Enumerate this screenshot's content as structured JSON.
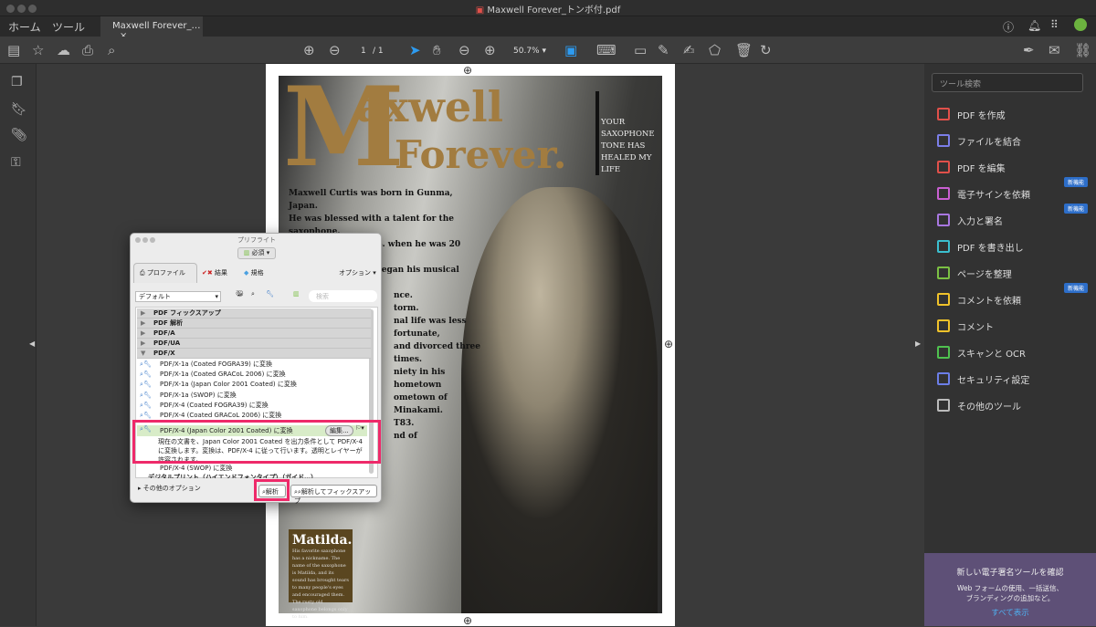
{
  "window": {
    "title": "Maxwell Forever_トンボ付.pdf"
  },
  "tabs": {
    "home": "ホーム",
    "tools": "ツール",
    "document": "Maxwell Forever_…",
    "close": "×"
  },
  "toolbar": {
    "page_current": "1",
    "page_total": "/ 1",
    "zoom": "50.7%",
    "icons": [
      "save-icon",
      "star-icon",
      "cloud-upload-icon",
      "print-icon",
      "search-zoom-icon",
      "page-up-icon",
      "page-down-icon",
      "select-arrow-icon",
      "hand-icon",
      "zoom-out-icon",
      "zoom-in-icon",
      "fit-page-icon",
      "scroll-mode-icon",
      "comment-icon",
      "highlight-icon",
      "sign-icon",
      "stamp-icon",
      "delete-icon",
      "rotate-icon",
      "share-sign-icon",
      "mail-icon"
    ]
  },
  "document": {
    "title_m": "M",
    "title_1": "axwell",
    "title_2": "Forever.",
    "tagline": "YOUR SAXOPHONE TONE HAS HEALED MY LIFE",
    "bio": [
      "Maxwell Curtis was born in Gunma, Japan.",
      "He was blessed with a talent for the saxophone.",
      "He moved to the U.S. when he was 20 years old",
      "New York City and began his musical career.",
      "nce.",
      "torm.",
      "nal life was less fortunate,",
      "and divorced three times.",
      "niety in his hometown",
      "ometown of Minakami.",
      "T83.",
      "nd of"
    ],
    "matilda_title": "Matilda.",
    "matilda_text": "His favorite saxophone has a nickname. The name of the saxophone is Matilda, and its sound has brought tears to many people's eyes and encouraged them. The rusty old saxophone belongs only to him."
  },
  "right_panel": {
    "search_placeholder": "ツール検索",
    "items": [
      {
        "label": "PDF を作成",
        "color": "#e0504a"
      },
      {
        "label": "ファイルを結合",
        "color": "#7b7ee8"
      },
      {
        "label": "PDF を編集",
        "color": "#e0504a"
      },
      {
        "label": "電子サインを依頼",
        "color": "#c95fd1",
        "badge": "新機能"
      },
      {
        "label": "入力と署名",
        "color": "#a877e0",
        "badge": "新機能"
      },
      {
        "label": "PDF を書き出し",
        "color": "#3bbfcf"
      },
      {
        "label": "ページを整理",
        "color": "#7bc043"
      },
      {
        "label": "コメントを依頼",
        "color": "#f0c22a",
        "badge": "新機能"
      },
      {
        "label": "コメント",
        "color": "#f0c22a"
      },
      {
        "label": "スキャンと OCR",
        "color": "#4fc14f"
      },
      {
        "label": "セキュリティ設定",
        "color": "#6c7ee8"
      },
      {
        "label": "その他のツール",
        "color": "#bbbbbb"
      }
    ],
    "promo": {
      "title": "新しい電子署名ツールを確認",
      "text1": "Web フォームの使用、一括送信、",
      "text2": "ブランディングの追加など。",
      "link": "すべて表示"
    }
  },
  "preflight": {
    "title": "プリフライト",
    "mode": "必須",
    "tabs": [
      "プロファイル",
      "結果",
      "規格"
    ],
    "options": "オプション",
    "profile_select": "デフォルト",
    "search_placeholder": "検索",
    "groups": [
      "PDF フィックスアップ",
      "PDF 解析",
      "PDF/A",
      "PDF/UA",
      "PDF/X"
    ],
    "items": [
      "PDF/X-1a (Coated FOGRA39) に変換",
      "PDF/X-1a (Coated GRACoL 2006) に変換",
      "PDF/X-1a (Japan Color 2001 Coated) に変換",
      "PDF/X-1a (SWOP) に変換",
      "PDF/X-4 (Coated FOGRA39) に変換",
      "PDF/X-4 (Coated GRACoL 2006) に変換"
    ],
    "selected": "PDF/X-4 (Japan Color 2001 Coated) に変換",
    "edit": "編集...",
    "description": "現在の文書を、Japan Color 2001 Coated を出力条件として PDF/X-4 に変換します。変換は、PDF/X-4 に従って行います。透明とレイヤーが許容されます。",
    "after": "PDF/X-4 (SWOP) に変換",
    "cut": "デジタルプリント（ハイエンドフォンタイプ）（ガイド…）",
    "more_options": "その他のオプション",
    "analyze": "解析",
    "analyze_fix": "解析してフィックスアップ"
  },
  "colors": {
    "highlight": "#ee2a6a",
    "accent": "#2d9bf0",
    "promo_bg": "#5e5077"
  }
}
